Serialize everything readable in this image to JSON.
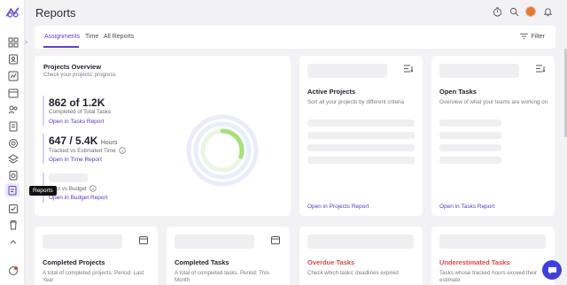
{
  "app": {
    "title": "Reports"
  },
  "tooltip": "Reports",
  "tabs": [
    {
      "label": "Assignments"
    },
    {
      "label": "Time"
    },
    {
      "label": "All Reports"
    }
  ],
  "filter_label": "Filter",
  "projects_overview": {
    "title": "Projects Overview",
    "subtitle": "Check your projects' progress",
    "metric1_value": "862 of 1.2K",
    "metric1_label": "Completed of Total Tasks",
    "metric1_link": "Open in Tasks Report",
    "metric2_value": "647 / 5.4K",
    "metric2_unit": "Hours",
    "metric2_label": "Tracked vs Estimated Time",
    "metric2_link": "Open in Time Report",
    "metric3_label": "Cost vs Budget",
    "metric3_link": "Open in Budget Report",
    "progress_fraction": 0.3
  },
  "active_projects": {
    "title": "Active Projects",
    "subtitle": "Sort all your projects by different criteria",
    "link": "Open in Projects Report"
  },
  "open_tasks": {
    "title": "Open Tasks",
    "subtitle": "Overview of what your teams are working on",
    "link": "Open in Tasks Report"
  },
  "completed_projects": {
    "title": "Completed Projects",
    "subtitle": "A total of completed projects. Period: Last Year"
  },
  "completed_tasks": {
    "title": "Completed Tasks",
    "subtitle": "A total of completed tasks. Period: This Month"
  },
  "overdue_tasks": {
    "title": "Overdue Tasks",
    "subtitle": "Check which tasks' deadlines expired"
  },
  "underestimated_tasks": {
    "title": "Underestimated Tasks",
    "subtitle": "Tasks whose tracked hours exceed their estimate"
  },
  "colors": {
    "accent": "#5b3fd6",
    "link": "#4b3ec8",
    "danger": "#e04545",
    "progress": "#a6e07a"
  }
}
